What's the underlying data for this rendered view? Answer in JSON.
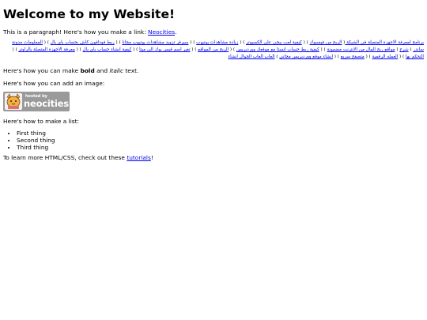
{
  "heading": "Welcome to my Website!",
  "intro": {
    "before": "This is a paragraph! Here's how you make a link: ",
    "link": "Neocities",
    "after": "."
  },
  "rtl_links": [
    "برنامج لمعرفة الاجهزة المتصلة في الشبكة ",
    "الربح من فيسبوك",
    "كيفية لعب ببجي على الكمبيوتر",
    "زيادة مشاهدات يوتيوب",
    "سيرفر تزويد مشاهدات يوتيوب مجانا",
    "ربط فودافون كاش بحساب باي بال",
    "المعلومات مدونة ساندر",
    "شرح",
    "مواقع ربح المال من الانترنت مضمونة",
    "كيفية ربط حساب انستا مع موقعك ووردبريس",
    "الربح من المواقع",
    "تغير اسم قيس بوك الى ميتا",
    "كيفية انشاء حساب باي بال",
    "معرفة الاجهزة المتصلة بالراوتر",
    "التحكم بها",
    "العمله الرقمية",
    "متصفح سريع",
    "انشاء موقع ووردبريس مجاني",
    "العاب العاب الجوال انشاء"
  ],
  "bold_line": {
    "before": "Here's how you can make ",
    "bold": "bold",
    "middle": " and ",
    "italic": "italic",
    "after": " text."
  },
  "image_line": "Here's how you can add an image:",
  "badge": {
    "hosted_by": "hosted by",
    "brand": "neocities"
  },
  "list_line": "Here's how to make a list:",
  "list_items": [
    "First thing",
    "Second thing",
    "Third thing"
  ],
  "learn": {
    "before": "To learn more HTML/CSS, check out these ",
    "link": "tutorials",
    "after": "!"
  }
}
